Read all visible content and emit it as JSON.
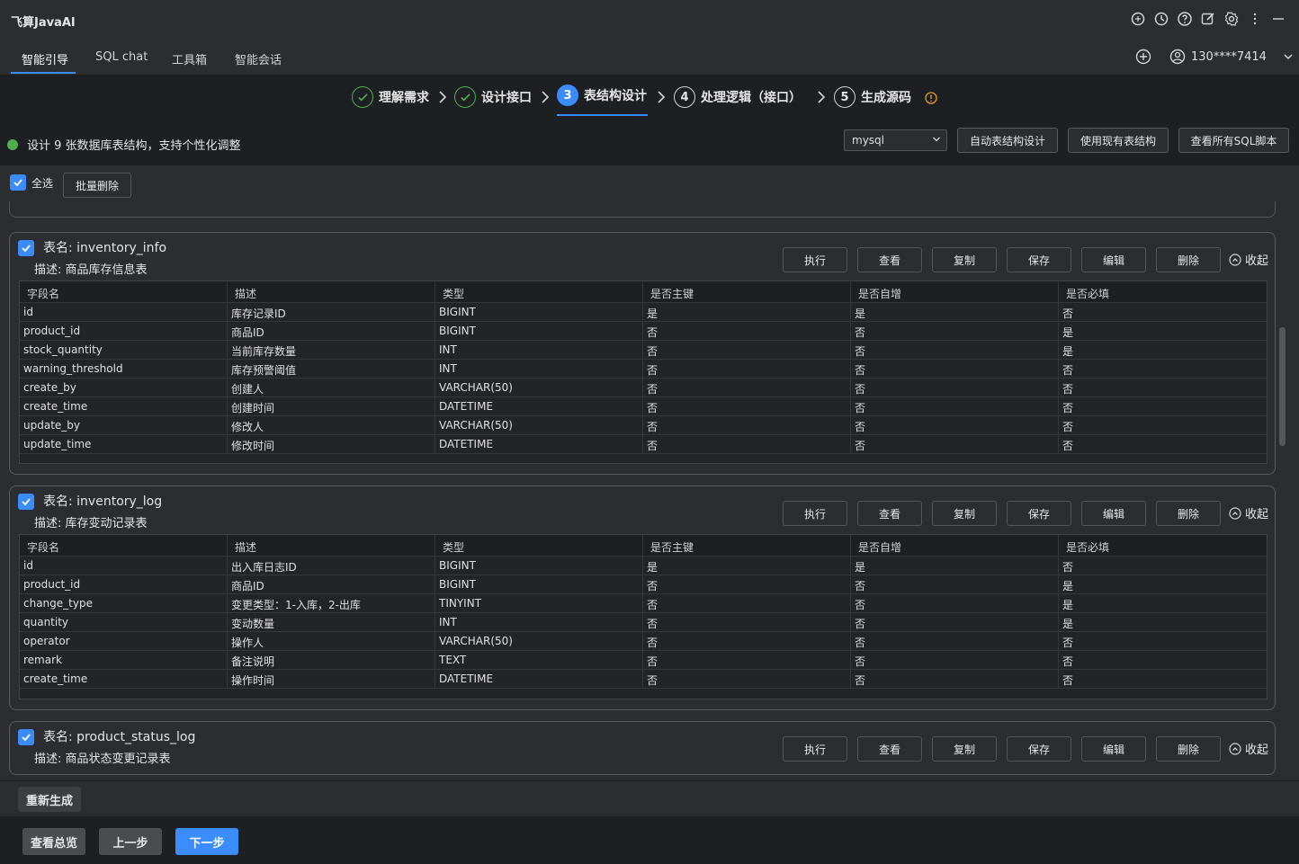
{
  "app": {
    "title": "飞算JavaAI"
  },
  "nav": {
    "tabs": [
      {
        "label": "智能引导"
      },
      {
        "label": "SQL chat"
      },
      {
        "label": "工具箱"
      },
      {
        "label": "智能会话"
      }
    ],
    "user": "130****7414"
  },
  "steps": [
    {
      "num": "",
      "label": "理解需求"
    },
    {
      "num": "",
      "label": "设计接口"
    },
    {
      "num": "3",
      "label": "表结构设计"
    },
    {
      "num": "4",
      "label": "处理逻辑（接口）"
    },
    {
      "num": "5",
      "label": "生成源码"
    }
  ],
  "info": {
    "message": "设计 9 张数据库表结构，支持个性化调整"
  },
  "db_select": {
    "value": "mysql"
  },
  "top_buttons": {
    "auto": "自动表结构设计",
    "existing": "使用现有表结构",
    "view_sql": "查看所有SQL脚本"
  },
  "select_all": {
    "label": "全选",
    "batch_delete": "批量删除"
  },
  "actions": {
    "execute": "执行",
    "view": "查看",
    "copy": "复制",
    "save": "保存",
    "edit": "编辑",
    "delete": "删除",
    "collapse": "收起"
  },
  "columns": [
    "字段名",
    "描述",
    "类型",
    "是否主键",
    "是否自增",
    "是否必填"
  ],
  "tables": [
    {
      "name": "表名: inventory_info",
      "desc": "描述: 商品库存信息表",
      "rows": [
        [
          "id",
          "库存记录ID",
          "BIGINT",
          "是",
          "是",
          "否"
        ],
        [
          "product_id",
          "商品ID",
          "BIGINT",
          "否",
          "否",
          "是"
        ],
        [
          "stock_quantity",
          "当前库存数量",
          "INT",
          "否",
          "否",
          "是"
        ],
        [
          "warning_threshold",
          "库存预警阈值",
          "INT",
          "否",
          "否",
          "否"
        ],
        [
          "create_by",
          "创建人",
          "VARCHAR(50)",
          "否",
          "否",
          "否"
        ],
        [
          "create_time",
          "创建时间",
          "DATETIME",
          "否",
          "否",
          "否"
        ],
        [
          "update_by",
          "修改人",
          "VARCHAR(50)",
          "否",
          "否",
          "否"
        ],
        [
          "update_time",
          "修改时间",
          "DATETIME",
          "否",
          "否",
          "否"
        ]
      ]
    },
    {
      "name": "表名: inventory_log",
      "desc": "描述: 库存变动记录表",
      "rows": [
        [
          "id",
          "出入库日志ID",
          "BIGINT",
          "是",
          "是",
          "否"
        ],
        [
          "product_id",
          "商品ID",
          "BIGINT",
          "否",
          "否",
          "是"
        ],
        [
          "change_type",
          "变更类型：1-入库，2-出库",
          "TINYINT",
          "否",
          "否",
          "是"
        ],
        [
          "quantity",
          "变动数量",
          "INT",
          "否",
          "否",
          "是"
        ],
        [
          "operator",
          "操作人",
          "VARCHAR(50)",
          "否",
          "否",
          "否"
        ],
        [
          "remark",
          "备注说明",
          "TEXT",
          "否",
          "否",
          "否"
        ],
        [
          "create_time",
          "操作时间",
          "DATETIME",
          "否",
          "否",
          "否"
        ]
      ]
    },
    {
      "name": "表名: product_status_log",
      "desc": "描述: 商品状态变更记录表",
      "rows": []
    }
  ],
  "bottom": {
    "regenerate": "重新生成"
  },
  "footer": {
    "overview": "查看总览",
    "prev": "上一步",
    "next": "下一步"
  },
  "colors": {
    "accent": "#3b8cff",
    "success": "#4caf50",
    "warning": "#e0a020"
  }
}
